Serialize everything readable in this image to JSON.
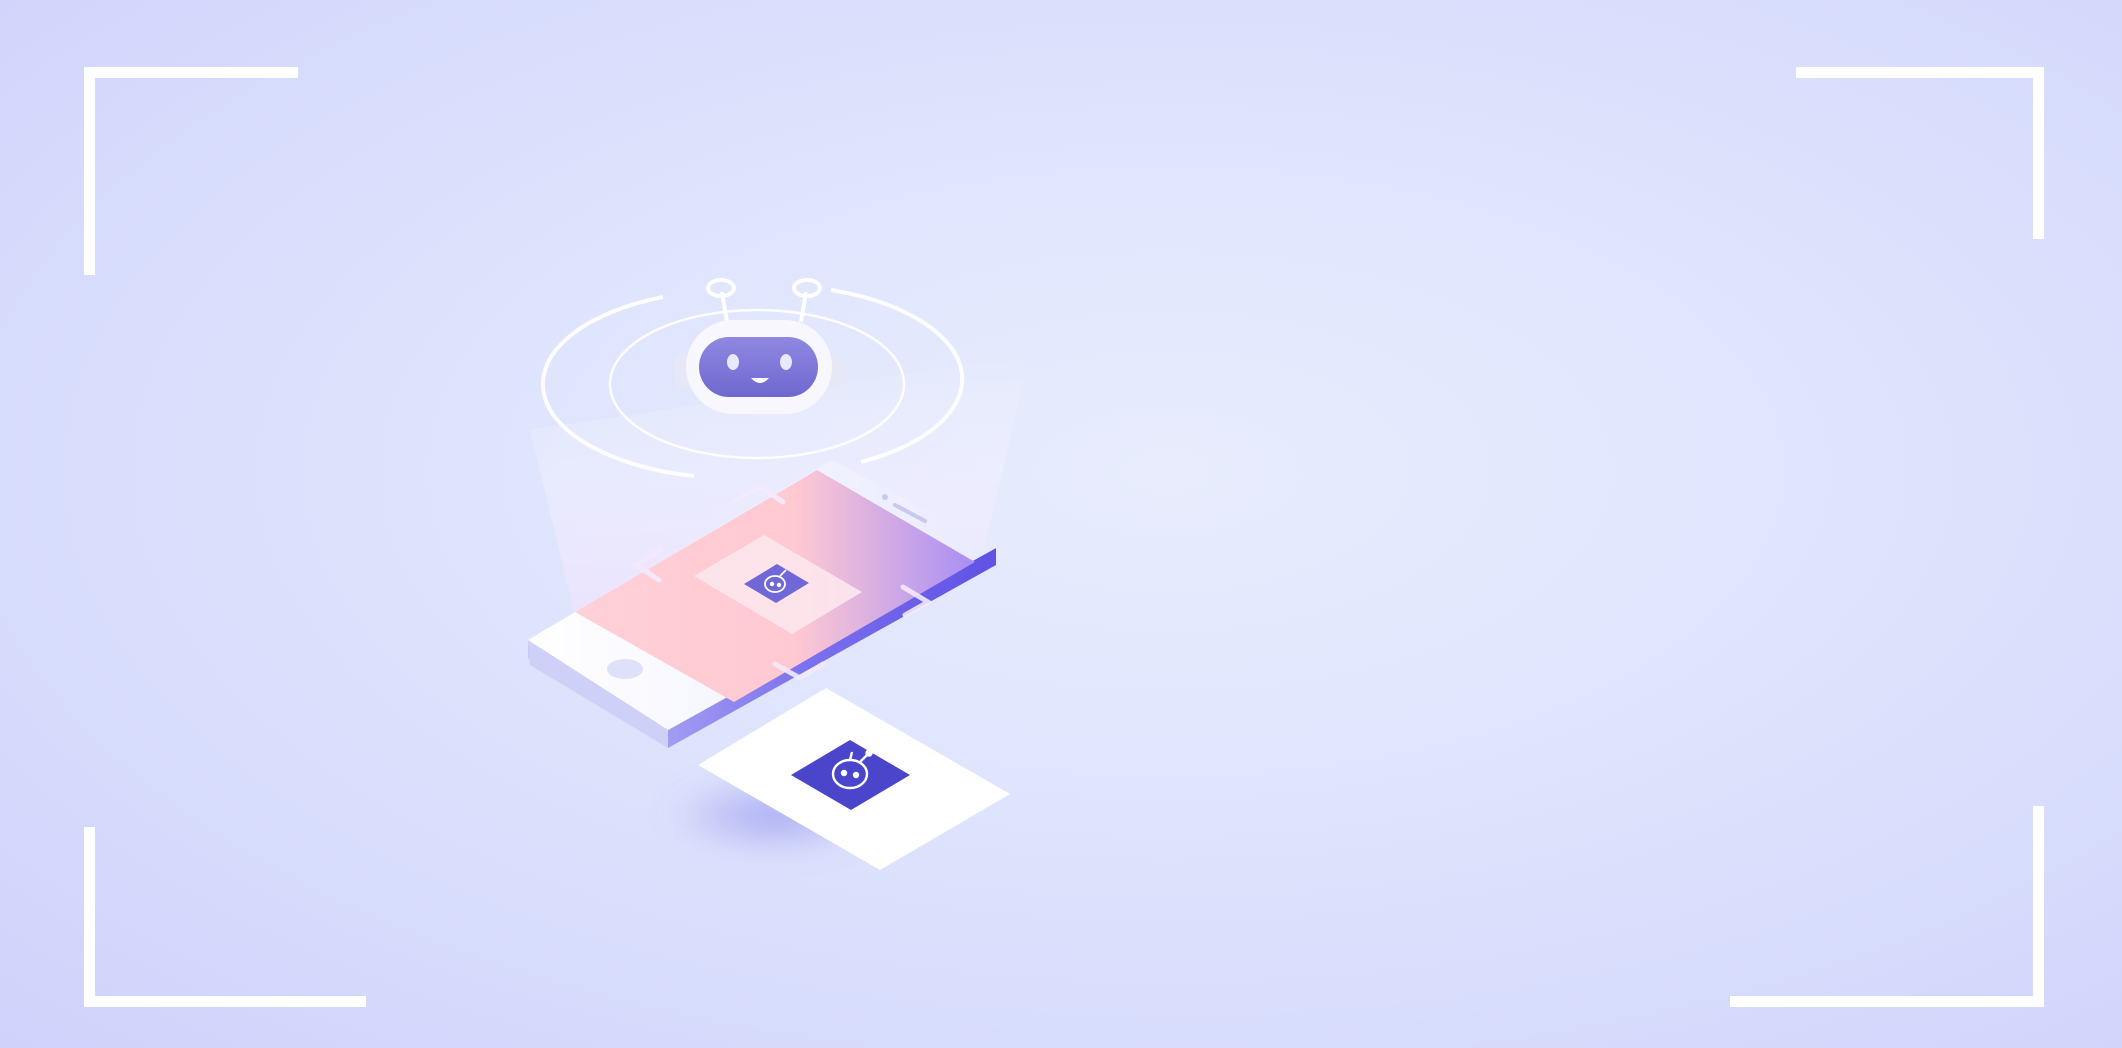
{
  "scene": {
    "subject": "robot-on-smartphone-illustration",
    "colors": {
      "background": "#dfe4fd",
      "frame": "#ffffff",
      "robot_face": "#7b75d6",
      "phone_screen_pink": "#ffcfd6",
      "phone_screen_violet": "#a98cf4",
      "card_icon": "#4a46cc"
    },
    "icons": [
      "robot-head-icon",
      "robot-badge-icon",
      "chevron-up-icon",
      "chevron-down-icon",
      "chevron-left-icon",
      "chevron-right-icon"
    ]
  }
}
